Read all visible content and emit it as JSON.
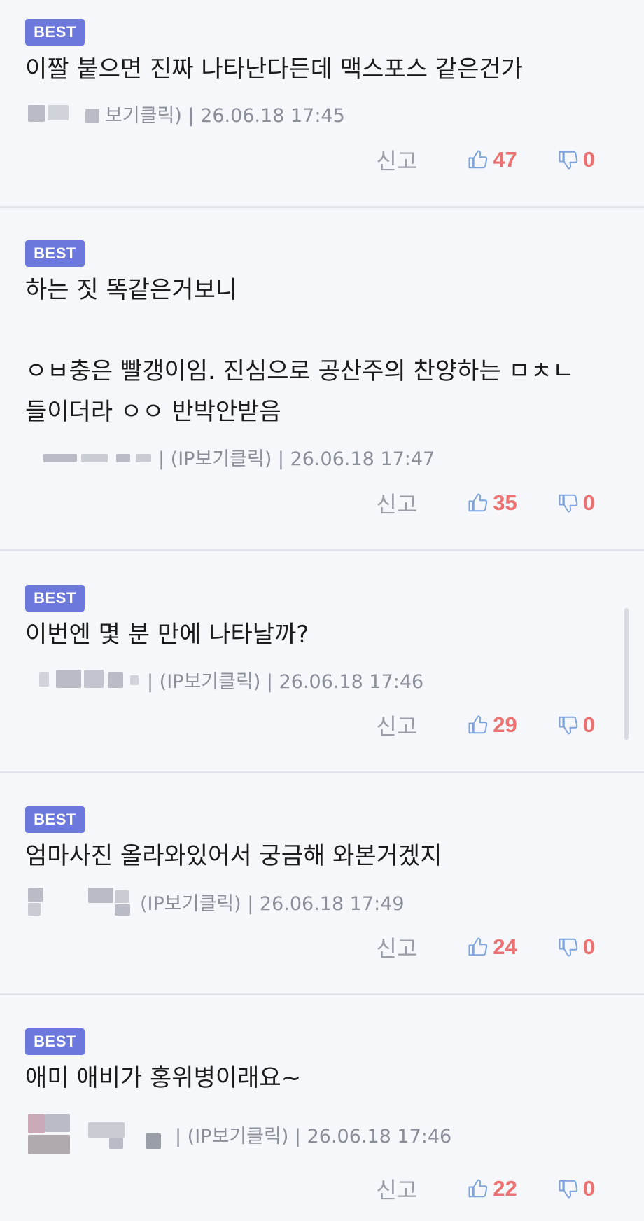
{
  "badge_label": "BEST",
  "report_label": "신고",
  "colors": {
    "badge": "#6d78dc",
    "count": "#ec7272",
    "icon": "#7fa4dc",
    "meta": "#8a8f99"
  },
  "comments": [
    {
      "lines": [
        "이짤 붙으면 진짜 나타난다든데 맥스포스 같은건가"
      ],
      "meta": "보기클릭) | 26.06.18 17:45",
      "likes": "47",
      "dislikes": "0"
    },
    {
      "lines": [
        "하는 짓 똑같은거보니",
        "",
        "ㅇㅂ충은 빨갱이임. 진심으로 공산주의 찬양하는 ㅁㅊㄴ",
        "들이더라 ㅇㅇ 반박안받음"
      ],
      "meta": "| (IP보기클릭) | 26.06.18 17:47",
      "likes": "35",
      "dislikes": "0"
    },
    {
      "lines": [
        "이번엔 몇 분 만에 나타날까?"
      ],
      "meta": "| (IP보기클릭) | 26.06.18 17:46",
      "likes": "29",
      "dislikes": "0"
    },
    {
      "lines": [
        "엄마사진 올라와있어서 궁금해 와본거겠지"
      ],
      "meta": "(IP보기클릭) | 26.06.18 17:49",
      "likes": "24",
      "dislikes": "0"
    },
    {
      "lines": [
        "애미 애비가 홍위병이래요~"
      ],
      "meta": "| (IP보기클릭) | 26.06.18 17:46",
      "likes": "22",
      "dislikes": "0"
    }
  ]
}
